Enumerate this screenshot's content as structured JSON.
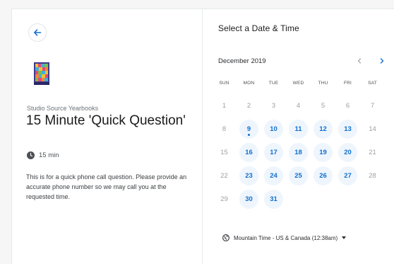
{
  "event": {
    "organization": "Studio Source Yearbooks",
    "title": "15 Minute 'Quick Question'",
    "duration": "15 min",
    "description": "This is for a quick phone call question. Please provide an accurate phone number so we may call you at the requested time."
  },
  "calendar": {
    "heading": "Select a Date & Time",
    "month": "December 2019",
    "prev_glyph": "<",
    "next_glyph": ">",
    "weekdays": [
      "SUN",
      "MON",
      "TUE",
      "WED",
      "THU",
      "FRI",
      "SAT"
    ],
    "days": [
      {
        "d": "1",
        "avail": false
      },
      {
        "d": "2",
        "avail": false
      },
      {
        "d": "3",
        "avail": false
      },
      {
        "d": "4",
        "avail": false
      },
      {
        "d": "5",
        "avail": false
      },
      {
        "d": "6",
        "avail": false
      },
      {
        "d": "7",
        "avail": false
      },
      {
        "d": "8",
        "avail": false
      },
      {
        "d": "9",
        "avail": true,
        "today": true
      },
      {
        "d": "10",
        "avail": true
      },
      {
        "d": "11",
        "avail": true
      },
      {
        "d": "12",
        "avail": true
      },
      {
        "d": "13",
        "avail": true
      },
      {
        "d": "14",
        "avail": false
      },
      {
        "d": "15",
        "avail": false
      },
      {
        "d": "16",
        "avail": true
      },
      {
        "d": "17",
        "avail": true
      },
      {
        "d": "18",
        "avail": true
      },
      {
        "d": "19",
        "avail": true
      },
      {
        "d": "20",
        "avail": true
      },
      {
        "d": "21",
        "avail": false
      },
      {
        "d": "22",
        "avail": false
      },
      {
        "d": "23",
        "avail": true
      },
      {
        "d": "24",
        "avail": true
      },
      {
        "d": "25",
        "avail": true
      },
      {
        "d": "26",
        "avail": true
      },
      {
        "d": "27",
        "avail": true
      },
      {
        "d": "28",
        "avail": false
      },
      {
        "d": "29",
        "avail": false
      },
      {
        "d": "30",
        "avail": true
      },
      {
        "d": "31",
        "avail": true
      }
    ]
  },
  "timezone": {
    "label": "Mountain Time - US & Canada (12:38am)"
  },
  "colors": {
    "accent": "#0f6fcf",
    "available_bg": "#eef5fd"
  }
}
